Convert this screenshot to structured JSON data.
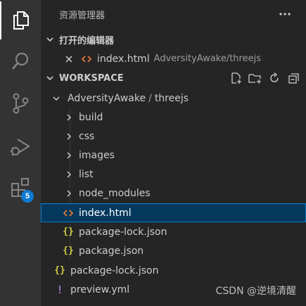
{
  "sidebar": {
    "title": "资源管理器",
    "open_editors": {
      "title": "打开的编辑器",
      "items": [
        {
          "name": "index.html",
          "path": "AdversityAwake/threejs"
        }
      ]
    },
    "workspace": {
      "title": "WORKSPACE",
      "root": {
        "parent": "AdversityAwake",
        "separator": "/",
        "name": "threejs"
      },
      "folders": [
        {
          "label": "build"
        },
        {
          "label": "css"
        },
        {
          "label": "images"
        },
        {
          "label": "list"
        },
        {
          "label": "node_modules"
        }
      ],
      "files": [
        {
          "label": "index.html",
          "icon_glyph": "<>"
        },
        {
          "label": "package-lock.json",
          "icon_glyph": "{}"
        },
        {
          "label": "package.json",
          "icon_glyph": "{}"
        }
      ],
      "root_files": [
        {
          "label": "package-lock.json",
          "icon_glyph": "{}"
        },
        {
          "label": "preview.yml",
          "icon_glyph": "!"
        }
      ]
    }
  },
  "activity_bar": {
    "extensions_badge": "5"
  },
  "watermark": "CSDN @逆境清醒",
  "colors": {
    "html_icon": "#e37933",
    "json_icon": "#cbcb41",
    "yml_icon": "#a074c4",
    "selection": "#04395e",
    "focus_border": "#007fd4",
    "badge": "#0e7ad3"
  }
}
